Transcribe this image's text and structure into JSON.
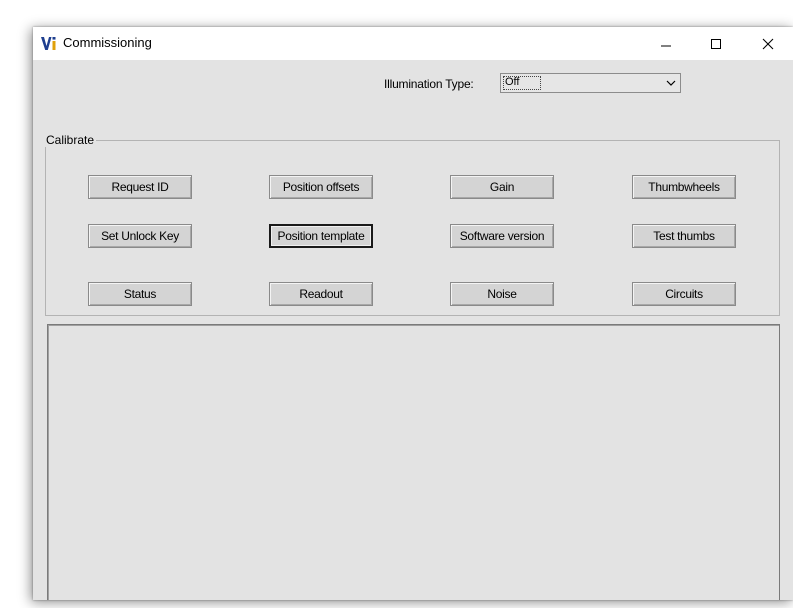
{
  "window": {
    "title": "Commissioning",
    "icon": "vi-logo-icon",
    "controls": [
      "minimize-icon",
      "maximize-icon",
      "close-icon"
    ]
  },
  "illumination": {
    "label": "Illumination Type:",
    "selected": "Off"
  },
  "calibrate": {
    "legend": "Calibrate",
    "buttons": [
      [
        "Request ID",
        "Position offsets",
        "Gain",
        "Thumbwheels"
      ],
      [
        "Set Unlock Key",
        "Position template",
        "Software version",
        "Test thumbs"
      ],
      [
        "Status",
        "Readout",
        "Noise",
        "Circuits"
      ]
    ],
    "focused": "Position template"
  },
  "output": {
    "text": ""
  },
  "colors": {
    "window_bg": "#e3e3e3",
    "button_bg": "#d4d4d4",
    "logo_blue": "#1f3f8f",
    "logo_gold": "#e0a10a"
  }
}
